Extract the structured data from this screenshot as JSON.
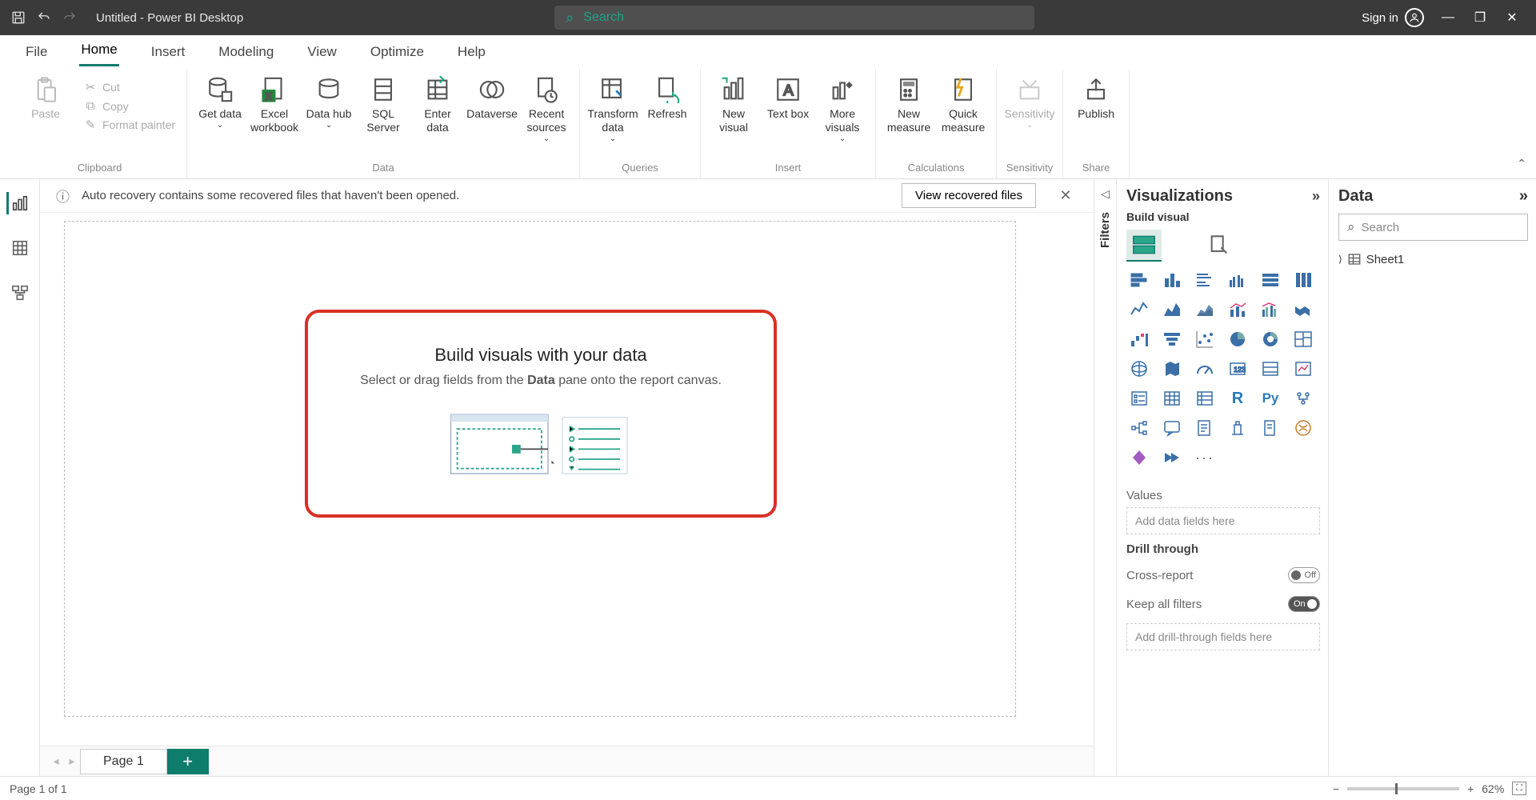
{
  "titlebar": {
    "title": "Untitled - Power BI Desktop",
    "search_placeholder": "Search",
    "signin": "Sign in"
  },
  "menu": {
    "file": "File",
    "home": "Home",
    "insert": "Insert",
    "modeling": "Modeling",
    "view": "View",
    "optimize": "Optimize",
    "help": "Help"
  },
  "ribbon": {
    "clipboard": {
      "paste": "Paste",
      "cut": "Cut",
      "copy": "Copy",
      "format": "Format painter",
      "label": "Clipboard"
    },
    "data": {
      "get": "Get data",
      "excel": "Excel workbook",
      "hub": "Data hub",
      "sql": "SQL Server",
      "enter": "Enter data",
      "dataverse": "Dataverse",
      "recent": "Recent sources",
      "label": "Data"
    },
    "queries": {
      "transform": "Transform data",
      "refresh": "Refresh",
      "label": "Queries"
    },
    "insert": {
      "newvis": "New visual",
      "textbox": "Text box",
      "more": "More visuals",
      "label": "Insert"
    },
    "calc": {
      "newm": "New measure",
      "quickm": "Quick measure",
      "label": "Calculations"
    },
    "sens": {
      "btn": "Sensitivity",
      "label": "Sensitivity"
    },
    "share": {
      "btn": "Publish",
      "label": "Share"
    }
  },
  "notice": {
    "text": "Auto recovery contains some recovered files that haven't been opened.",
    "btn": "View recovered files"
  },
  "hint": {
    "title": "Build visuals with your data",
    "text_pre": "Select or drag fields from the ",
    "text_bold": "Data",
    "text_post": " pane onto the report canvas."
  },
  "tabs": {
    "page1": "Page 1"
  },
  "filters": {
    "label": "Filters"
  },
  "viz": {
    "title": "Visualizations",
    "sub": "Build visual",
    "values": "Values",
    "drop1": "Add data fields here",
    "drill": "Drill through",
    "cross": "Cross-report",
    "keep": "Keep all filters",
    "off": "Off",
    "on": "On",
    "drop2": "Add drill-through fields here"
  },
  "data": {
    "title": "Data",
    "search": "Search",
    "table": "Sheet1"
  },
  "status": {
    "page": "Page 1 of 1",
    "zoom": "62%"
  }
}
